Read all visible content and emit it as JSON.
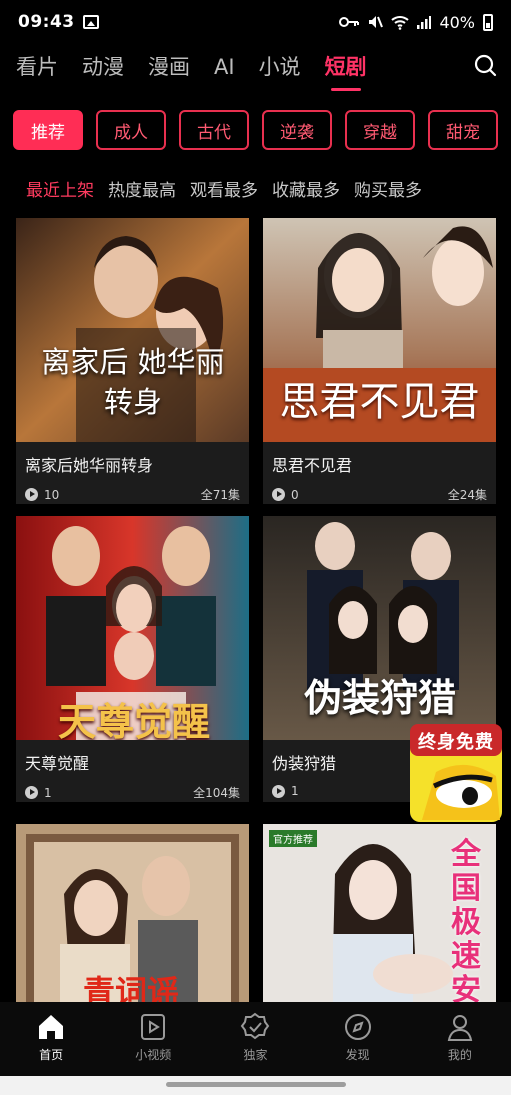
{
  "status": {
    "time": "09:43",
    "battery": "40%"
  },
  "top_tabs": [
    {
      "label": "看片"
    },
    {
      "label": "动漫"
    },
    {
      "label": "漫画"
    },
    {
      "label": "AI"
    },
    {
      "label": "小说"
    },
    {
      "label": "短剧",
      "active": true
    }
  ],
  "genres": [
    "推荐",
    "成人",
    "古代",
    "逆袭",
    "穿越",
    "甜宠"
  ],
  "sorts": [
    "最近上架",
    "热度最高",
    "观看最多",
    "收藏最多",
    "购买最多"
  ],
  "cards": [
    {
      "poster_text": "离家后 她华丽转身",
      "title": "离家后她华丽转身",
      "views": "10",
      "episodes": "全71集"
    },
    {
      "poster_text": "思君不见君",
      "title": "思君不见君",
      "views": "0",
      "episodes": "全24集"
    },
    {
      "poster_text": "天尊觉醒",
      "title": "天尊觉醒",
      "views": "1",
      "episodes": "全104集"
    },
    {
      "poster_text": "伪装狩猎",
      "title": "伪装狩猎",
      "views": "1",
      "episodes": ""
    },
    {
      "poster_text": "青词谣",
      "title": "",
      "views": "",
      "episodes": ""
    },
    {
      "poster_text": "全国极速安",
      "poster_tag": "官方推荐",
      "title": "",
      "views": "",
      "episodes": ""
    }
  ],
  "promo_badge": {
    "text": "终身免费"
  },
  "bottom_nav": [
    {
      "label": "首页",
      "icon": "home-icon",
      "active": true
    },
    {
      "label": "小视频",
      "icon": "video-icon"
    },
    {
      "label": "独家",
      "icon": "badge-check-icon"
    },
    {
      "label": "发现",
      "icon": "compass-icon"
    },
    {
      "label": "我的",
      "icon": "user-icon"
    }
  ],
  "colors": {
    "accent": "#ff2d55",
    "background": "#000000",
    "card": "#1c1c1c"
  }
}
